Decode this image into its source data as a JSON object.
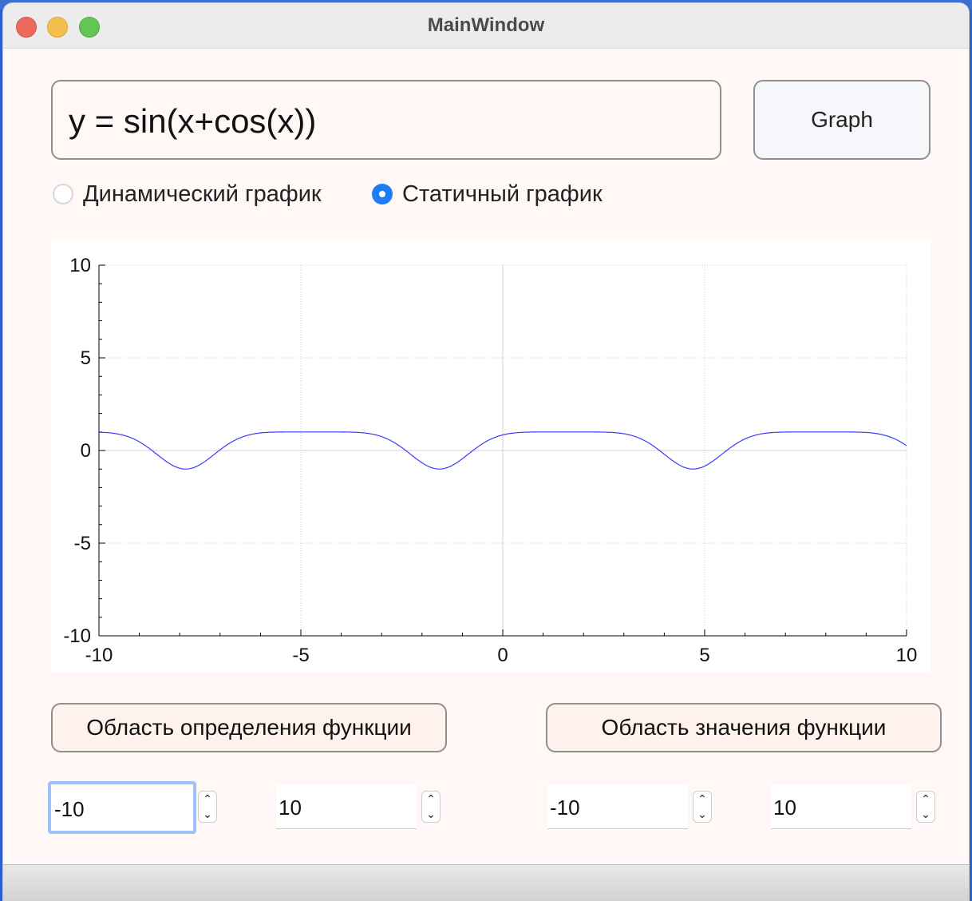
{
  "window": {
    "title": "MainWindow"
  },
  "formula_input": {
    "value": "y = sin(x+cos(x))"
  },
  "graph_button": {
    "label": "Graph"
  },
  "mode": {
    "options": [
      {
        "label": "Динамический график",
        "selected": false
      },
      {
        "label": "Статичный график",
        "selected": true
      }
    ]
  },
  "buttons": {
    "domain": "Область определения функции",
    "range": "Область значения функции"
  },
  "spinboxes": {
    "x_min": "-10",
    "x_max": "10",
    "y_min": "-10",
    "y_max": "10"
  },
  "stepper": {
    "up": "⌃",
    "down": "⌄"
  },
  "colors": {
    "curve": "#3a3aff",
    "accent": "#1d7df2"
  },
  "chart_data": {
    "type": "line",
    "function": "sin(x+cos(x))",
    "xlim": [
      -10,
      10
    ],
    "ylim": [
      -10,
      10
    ],
    "xticks": [
      "-10",
      "-5",
      "0",
      "5",
      "10"
    ],
    "yticks": [
      "10",
      "5",
      "0",
      "-5",
      "-10"
    ],
    "grid": true,
    "series": [
      {
        "expr": "sin(x+cos(x))"
      }
    ]
  }
}
